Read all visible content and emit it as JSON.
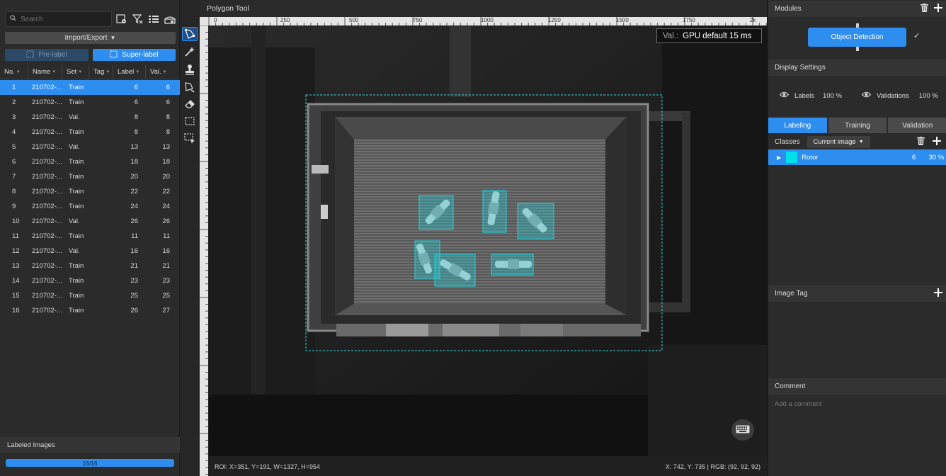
{
  "left_panel": {
    "search_placeholder": "Search",
    "import_export_label": "Import/Export",
    "prelabel_label": "Pre-label",
    "superlabel_label": "Super-label",
    "columns": [
      "No.",
      "Name",
      "Set",
      "Tag",
      "Label",
      "Val."
    ],
    "rows": [
      {
        "no": "1",
        "name": "210702-...",
        "set": "Train",
        "tag": "",
        "label": "6",
        "val": "6"
      },
      {
        "no": "2",
        "name": "210702-...",
        "set": "Train",
        "tag": "",
        "label": "6",
        "val": "6"
      },
      {
        "no": "3",
        "name": "210702-...",
        "set": "Val.",
        "tag": "",
        "label": "8",
        "val": "8"
      },
      {
        "no": "4",
        "name": "210702-...",
        "set": "Train",
        "tag": "",
        "label": "8",
        "val": "8"
      },
      {
        "no": "5",
        "name": "210702-...",
        "set": "Val.",
        "tag": "",
        "label": "13",
        "val": "13"
      },
      {
        "no": "6",
        "name": "210702-...",
        "set": "Train",
        "tag": "",
        "label": "18",
        "val": "18"
      },
      {
        "no": "7",
        "name": "210702-...",
        "set": "Train",
        "tag": "",
        "label": "20",
        "val": "20"
      },
      {
        "no": "8",
        "name": "210702-...",
        "set": "Train",
        "tag": "",
        "label": "22",
        "val": "22"
      },
      {
        "no": "9",
        "name": "210702-...",
        "set": "Train",
        "tag": "",
        "label": "24",
        "val": "24"
      },
      {
        "no": "10",
        "name": "210702-...",
        "set": "Val.",
        "tag": "",
        "label": "26",
        "val": "26"
      },
      {
        "no": "11",
        "name": "210702-...",
        "set": "Train",
        "tag": "",
        "label": "11",
        "val": "11"
      },
      {
        "no": "12",
        "name": "210702-...",
        "set": "Val.",
        "tag": "",
        "label": "16",
        "val": "16"
      },
      {
        "no": "13",
        "name": "210702-...",
        "set": "Train",
        "tag": "",
        "label": "21",
        "val": "21"
      },
      {
        "no": "14",
        "name": "210702-...",
        "set": "Train",
        "tag": "",
        "label": "23",
        "val": "23"
      },
      {
        "no": "15",
        "name": "210702-...",
        "set": "Train",
        "tag": "",
        "label": "25",
        "val": "25"
      },
      {
        "no": "16",
        "name": "210702-...",
        "set": "Train",
        "tag": "",
        "label": "26",
        "val": "27"
      }
    ],
    "selected_row": 0,
    "labeled_images_title": "Labeled Images",
    "labeled_progress_text": "16/16",
    "labeled_progress_fraction": 1.0
  },
  "canvas": {
    "tool_title": "Polygon Tool",
    "ruler_ticks": [
      "0",
      "250",
      "500",
      "750",
      "1000",
      "1250",
      "1500",
      "1750",
      "2k"
    ],
    "val_label": "Val.:",
    "val_value": "GPU default 15 ms",
    "roi_text": "ROI: X=351, Y=191, W=1327, H=954",
    "cursor_text": "X: 742, Y: 735 | RGB: (92, 92, 92)"
  },
  "right_panel": {
    "modules_title": "Modules",
    "module_name": "Object Detection",
    "display_settings_title": "Display Settings",
    "labels_label": "Labels",
    "labels_value": "100 %",
    "validations_label": "Validations",
    "validations_value": "100 %",
    "tabs": [
      "Labeling",
      "Training",
      "Validation"
    ],
    "active_tab": 0,
    "classes_label": "Classes",
    "classes_filter": "Current image",
    "classes": [
      {
        "name": "Rotor",
        "count": "6",
        "percent": "30 %",
        "color": "#00e0e8"
      }
    ],
    "image_tag_title": "Image Tag",
    "comment_title": "Comment",
    "comment_placeholder": "Add a comment"
  },
  "colors": {
    "accent": "#2d8ef0",
    "label_cyan": "#22d3dc",
    "panel_bg": "#2b2b2b"
  }
}
